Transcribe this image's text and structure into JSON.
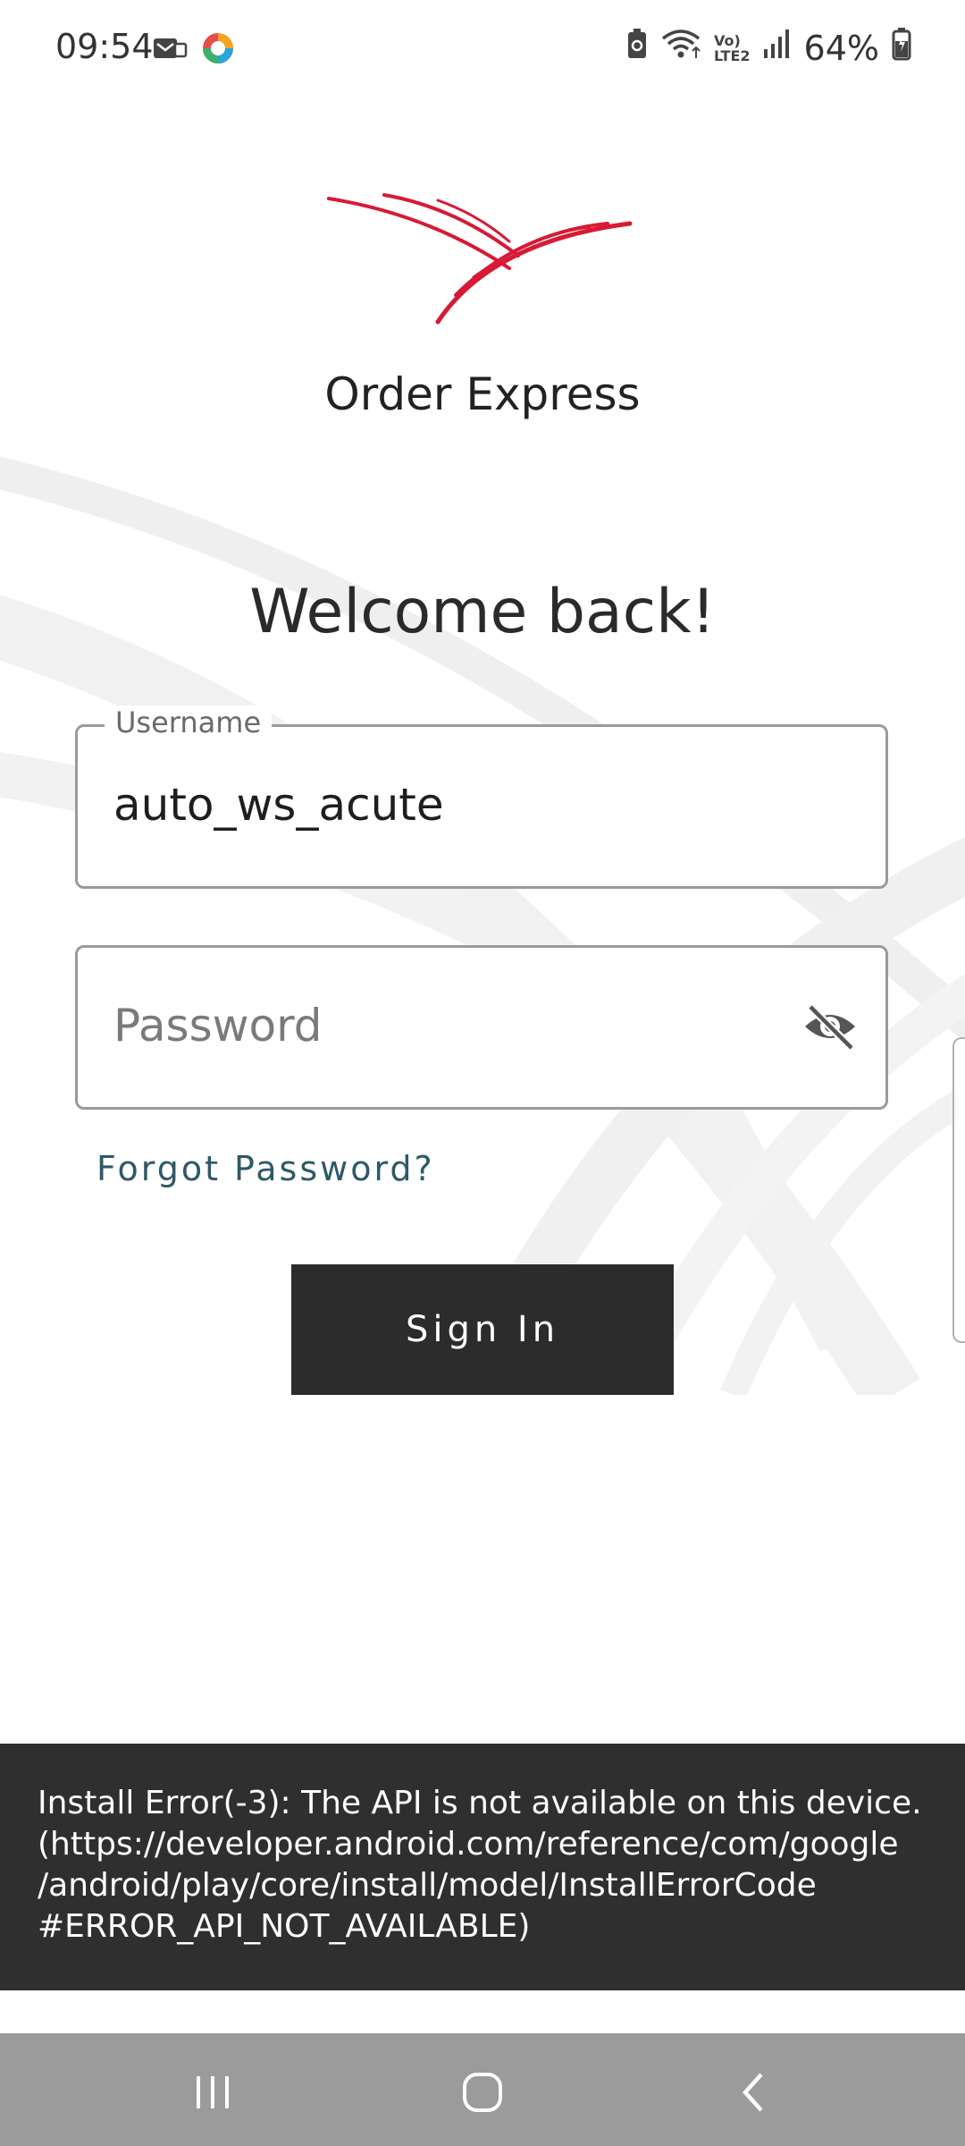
{
  "status_bar": {
    "time": "09:54",
    "battery_percent": "64%",
    "left_icons": [
      "message-icon",
      "app-notification-icon"
    ],
    "right_icons": [
      "battery-saver-icon",
      "wifi-icon",
      "volte-icon",
      "signal-icon",
      "battery-icon"
    ],
    "volte_label_top": "Vo)",
    "volte_label_bottom": "LTE2"
  },
  "brand": {
    "name": "Order Express",
    "logo_color": "#d71a35"
  },
  "login": {
    "welcome": "Welcome back!",
    "username_label": "Username",
    "username_value": "auto_ws_acute",
    "password_placeholder": "Password",
    "forgot_password": "Forgot Password?",
    "sign_in": "Sign In"
  },
  "snackbar": {
    "lines": [
      "Install Error(-3): The API is not available on this device.",
      "(https://developer.android.com/reference/com/google",
      "/android/play/core/install/model/InstallErrorCode",
      "#ERROR_API_NOT_AVAILABLE)"
    ]
  },
  "nav": {
    "buttons": [
      "recent-apps",
      "home",
      "back"
    ]
  }
}
